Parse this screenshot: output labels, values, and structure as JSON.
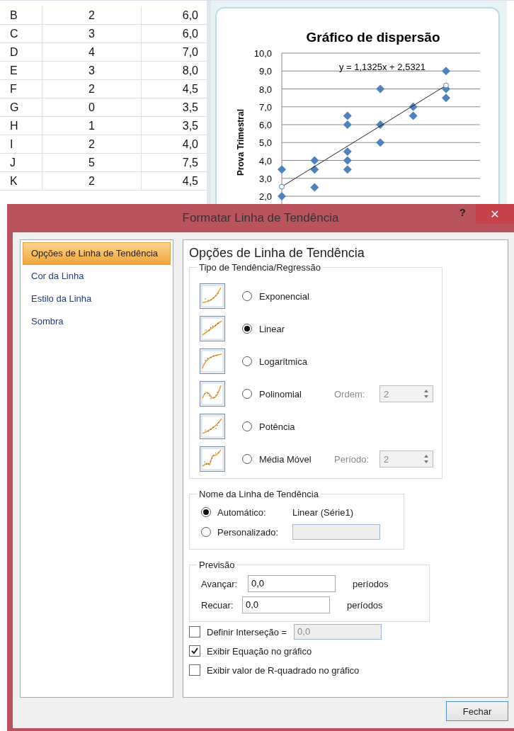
{
  "sheet": {
    "rows": [
      {
        "cells": [
          "B",
          "2",
          "6,0"
        ]
      },
      {
        "cells": [
          "C",
          "3",
          "6,0"
        ]
      },
      {
        "cells": [
          "D",
          "4",
          "7,0"
        ]
      },
      {
        "cells": [
          "E",
          "3",
          "8,0"
        ]
      },
      {
        "cells": [
          "F",
          "2",
          "4,5"
        ]
      },
      {
        "cells": [
          "G",
          "0",
          "3,5"
        ]
      },
      {
        "cells": [
          "H",
          "1",
          "3,5"
        ]
      },
      {
        "cells": [
          "I",
          "2",
          "4,0"
        ]
      },
      {
        "cells": [
          "J",
          "5",
          "7,5"
        ]
      },
      {
        "cells": [
          "K",
          "2",
          "4,5"
        ]
      }
    ],
    "chart": {
      "title": "Gráfico de dispersão",
      "ylabel": "Prova Trimestral",
      "tick_labels": [
        "10,0",
        "9,0",
        "8,0",
        "7,0",
        "6,0",
        "5,0",
        "4,0",
        "3,0",
        "2,0"
      ],
      "equation": "y = 1,1325x + 2,5321"
    }
  },
  "dialog": {
    "title": "Formatar Linha de Tendência",
    "help": "?",
    "close": "✕",
    "sidebar": {
      "items": [
        {
          "label": "Opções de Linha de Tendência",
          "selected": true
        },
        {
          "label": "Cor da Linha",
          "selected": false
        },
        {
          "label": "Estilo da Linha",
          "selected": false
        },
        {
          "label": "Sombra",
          "selected": false
        }
      ]
    },
    "heading": "Opções de Linha de Tendência",
    "trend_group": {
      "legend": "Tipo de Tendência/Regressão",
      "types": [
        {
          "kind": "exponential",
          "label": "Exponencial",
          "selected": false
        },
        {
          "kind": "linear",
          "label": "Linear",
          "selected": true
        },
        {
          "kind": "logarithmic",
          "label": "Logarítmica",
          "selected": false
        },
        {
          "kind": "polynomial",
          "label": "Polinomial",
          "selected": false,
          "param": {
            "label": "Ordem:",
            "value": "2",
            "disabled": true
          }
        },
        {
          "kind": "power",
          "label": "Potência",
          "selected": false
        },
        {
          "kind": "moving_average",
          "label": "Média Móvel",
          "selected": false,
          "param": {
            "label": "Período:",
            "value": "2",
            "disabled": true
          }
        }
      ]
    },
    "name_group": {
      "legend": "Nome da Linha de Tendência",
      "options": [
        {
          "label": "Automático:",
          "selected": true,
          "value": "Linear (Série1)"
        },
        {
          "label": "Personalizado:",
          "selected": false,
          "field_disabled": true
        }
      ]
    },
    "forecast_group": {
      "legend": "Previsão",
      "rows": [
        {
          "label": "Avançar:",
          "value": "0,0",
          "unit": "períodos"
        },
        {
          "label": "Recuar:",
          "value": "0,0",
          "unit": "períodos"
        }
      ]
    },
    "checks": [
      {
        "label": "Definir Interseção =",
        "checked": false,
        "field": {
          "value": "0,0",
          "disabled": true
        }
      },
      {
        "label": "Exibir Equação no gráfico",
        "checked": true
      },
      {
        "label": "Exibir valor de R-quadrado no gráfico",
        "checked": false
      }
    ],
    "button": "Fechar"
  }
}
